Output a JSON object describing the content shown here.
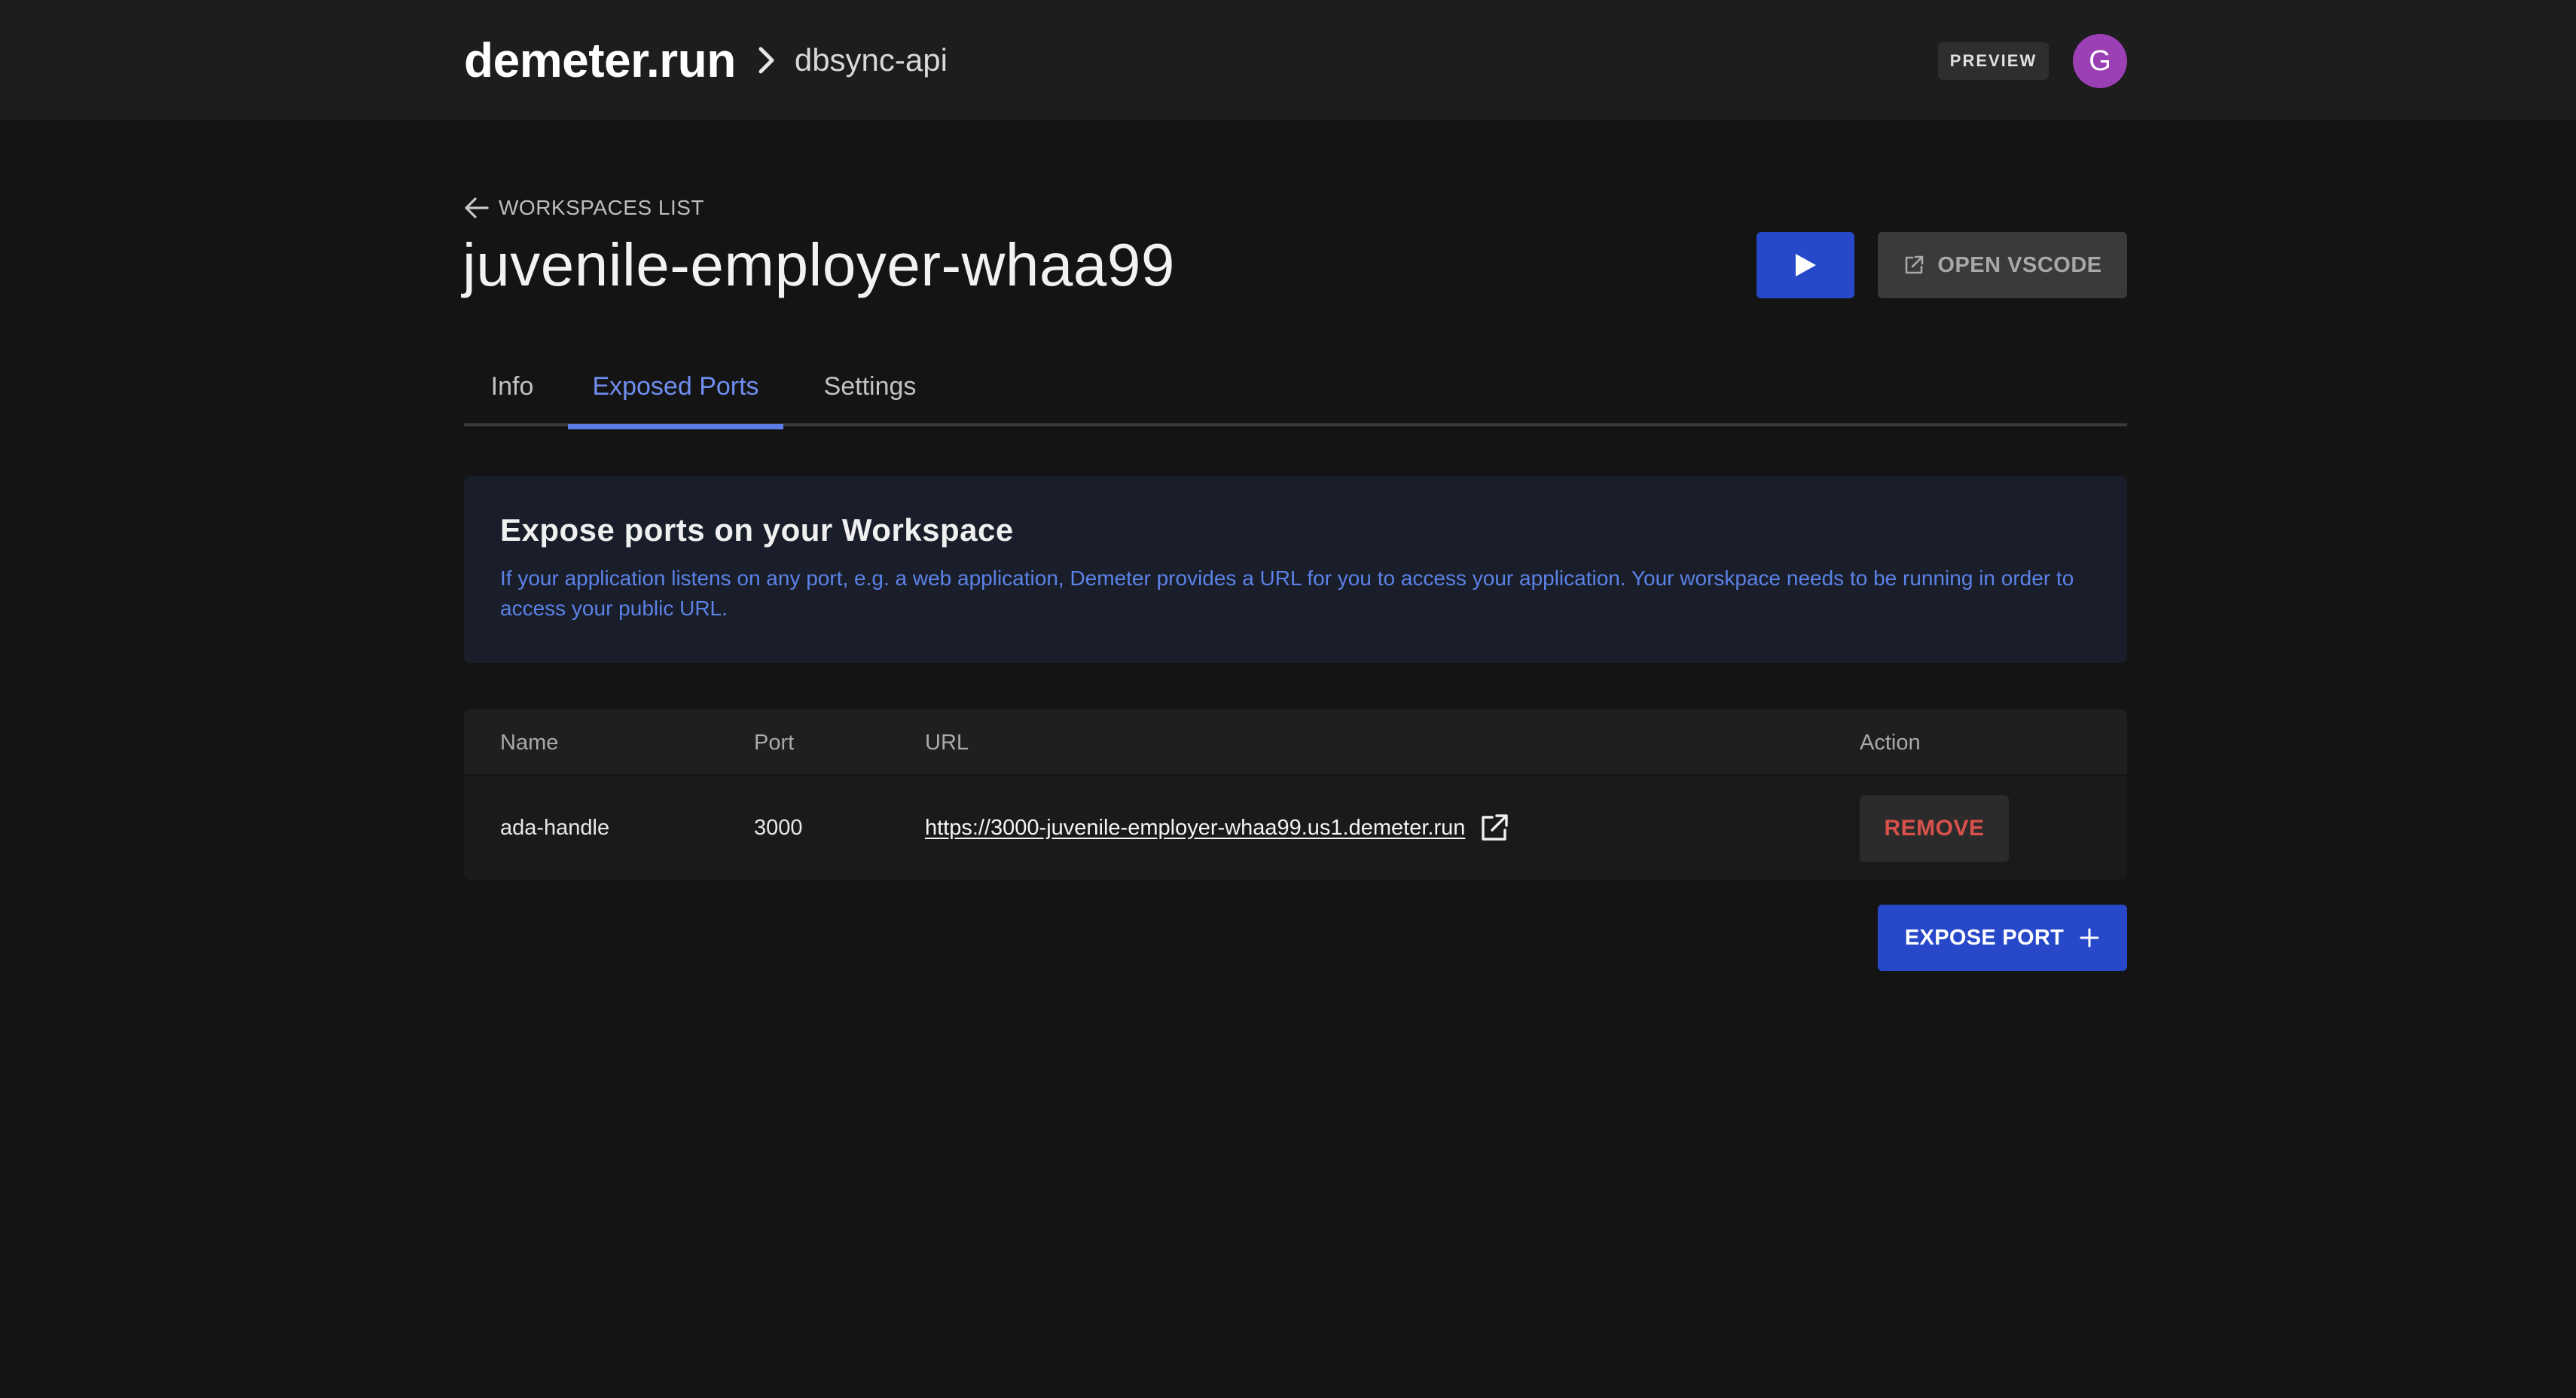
{
  "header": {
    "brand": "demeter.run",
    "project": "dbsync-api",
    "preview_label": "PREVIEW",
    "avatar_initial": "G",
    "avatar_color": "#9b3fb5",
    "separator_icon": "chevron-right-icon"
  },
  "page": {
    "back_label": "WORKSPACES LIST",
    "title": "juvenile-employer-whaa99",
    "run_icon": "play-icon",
    "open_vscode_label": "OPEN VSCODE",
    "open_vscode_icon": "external-link-icon"
  },
  "tabs": [
    {
      "label": "Info",
      "active": false
    },
    {
      "label": "Exposed Ports",
      "active": true
    },
    {
      "label": "Settings",
      "active": false
    }
  ],
  "banner": {
    "title": "Expose ports on your Workspace",
    "text": "If your application listens on any port, e.g. a web application, Demeter provides a URL for you to access your application. Your worskpace needs to be running in order to access your public URL."
  },
  "ports_table": {
    "columns": [
      "Name",
      "Port",
      "URL",
      "Action"
    ],
    "rows": [
      {
        "name": "ada-handle",
        "port": "3000",
        "url": "https://3000-juvenile-employer-whaa99.us1.demeter.run",
        "action_label": "REMOVE"
      }
    ]
  },
  "expose_button": {
    "label": "EXPOSE PORT",
    "icon": "plus-icon"
  },
  "colors": {
    "accent": "#2749c9",
    "active_tab": "#6f8ef0",
    "banner_text": "#5b82e6",
    "danger": "#d8514b"
  }
}
